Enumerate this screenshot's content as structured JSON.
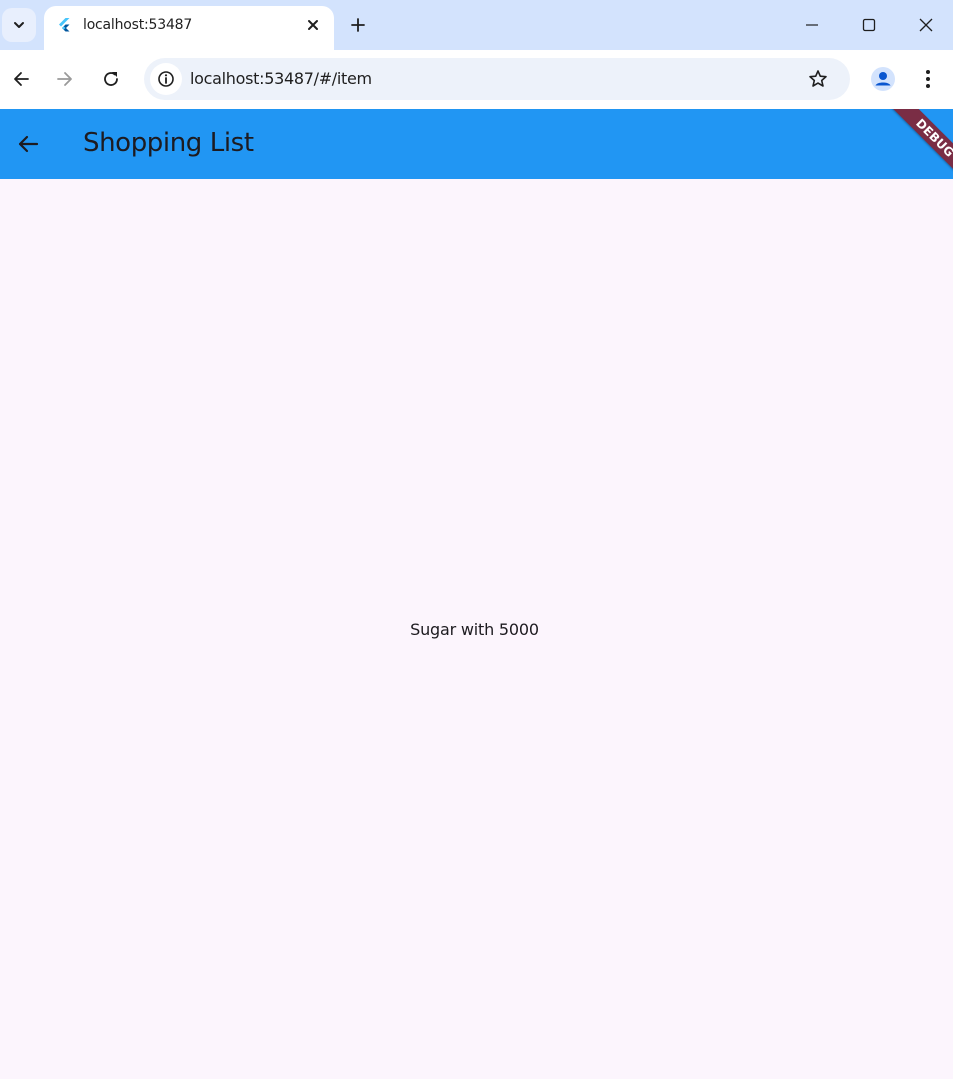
{
  "browser": {
    "tab": {
      "title": "localhost:53487"
    },
    "address_bar": {
      "url": "localhost:53487/#/item"
    },
    "icons": {
      "tab_search": "chevron-down-icon",
      "favicon": "flutter-icon",
      "tab_close": "close-icon",
      "new_tab": "plus-icon",
      "minimize": "minimize-icon",
      "maximize": "maximize-icon",
      "close_window": "close-icon",
      "back": "arrow-left-icon",
      "forward": "arrow-right-icon",
      "reload": "reload-icon",
      "site_info": "info-icon",
      "bookmark": "star-icon",
      "profile": "person-icon",
      "menu": "kebab-menu-icon"
    }
  },
  "app": {
    "appbar": {
      "title": "Shopping List",
      "color": "#2196f3"
    },
    "debug_banner": "DEBUG",
    "item": {
      "text": "Sugar with 5000"
    },
    "background": "#fcf5fd"
  }
}
